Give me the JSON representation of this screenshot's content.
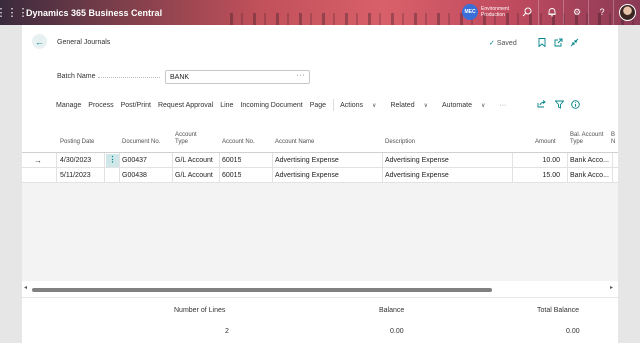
{
  "app": {
    "title": "Dynamics 365 Business Central",
    "env_badge": "MEC",
    "env_line1": "Environment",
    "env_line2": "Production"
  },
  "page": {
    "title": "General Journals",
    "saved": "Saved"
  },
  "batch": {
    "label": "Batch Name",
    "value": "BANK",
    "more": "···"
  },
  "actions": [
    "Manage",
    "Process",
    "Post/Print",
    "Request Approval",
    "Line",
    "Incoming Document",
    "Page"
  ],
  "menus": [
    "Actions",
    "Related",
    "Automate"
  ],
  "overflow": "···",
  "columns": {
    "posting_date": "Posting Date",
    "document_no": "Document No.",
    "account_type_1": "Account",
    "account_type_2": "Type",
    "account_no": "Account No.",
    "account_name": "Account Name",
    "description": "Description",
    "amount": "Amount",
    "bal_account_type_1": "Bal. Account",
    "bal_account_type_2": "Type",
    "extra_1": "B",
    "extra_2": "N"
  },
  "rows": [
    {
      "posting_date": "4/30/2023",
      "document_no": "G00437",
      "account_type": "G/L Account",
      "account_no": "60015",
      "account_name": "Advertising Expense",
      "description": "Advertising Expense",
      "amount": "10.00",
      "bal_account_type": "Bank Acco..."
    },
    {
      "posting_date": "5/11/2023",
      "document_no": "G00438",
      "account_type": "G/L Account",
      "account_no": "60015",
      "account_name": "Advertising Expense",
      "description": "Advertising Expense",
      "amount": "15.00",
      "bal_account_type": "Bank Acco..."
    }
  ],
  "totals": {
    "lines_label": "Number of Lines",
    "lines_value": "2",
    "balance_label": "Balance",
    "balance_value": "0.00",
    "total_label": "Total Balance",
    "total_value": "0.00"
  },
  "colors": {
    "accent": "#00838a",
    "topbar": "#c0505a"
  },
  "icons": [
    "app-launcher-icon",
    "search-icon",
    "bell-icon",
    "gear-icon",
    "help-icon",
    "back-arrow-icon",
    "bookmark-icon",
    "open-new-icon",
    "collapse-icon",
    "share-icon",
    "filter-icon",
    "info-icon",
    "row-arrow-icon",
    "row-menu-icon"
  ]
}
